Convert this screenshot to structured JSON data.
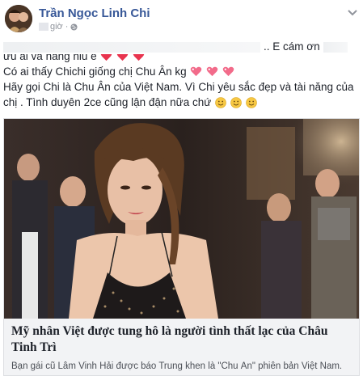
{
  "post": {
    "author": "Trần Ngọc Linh Chi",
    "time": "giờ",
    "lines": {
      "line1": ".. E cám ơn",
      "line2": "ưu ái và nâng niu e",
      "line3": "Có ai thấy Chichi giống chị Chu Ân kg",
      "line4": "Hãy gọi Chi là Chu Ân của Việt Nam. Vì Chi yêu sắc đẹp và tài năng của",
      "line5": "chị . Tình duyên 2ce cũng lận đận nữa chứ"
    },
    "icons": {
      "chevron": "chevron-down-icon",
      "globe": "globe-icon",
      "heart": "heart-icon",
      "sparkling_heart": "sparkling-heart-icon",
      "smile": "smile-emoji-icon"
    },
    "colors": {
      "author": "#385898",
      "heart": "#e8344e",
      "card_bg": "#f2f3f5"
    }
  },
  "link_card": {
    "title": "Mỹ nhân Việt được tung hô là người tình thất lạc của Châu Tinh Trì",
    "description": "Bạn gái cũ Lâm Vinh Hải được báo Trung khen là \"Chu Ân\" phiên bản Việt Nam."
  }
}
